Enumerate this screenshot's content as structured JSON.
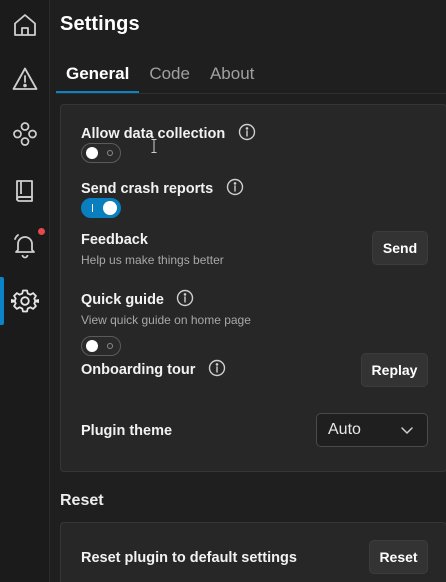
{
  "rail": {
    "items": [
      {
        "icon": "home-icon"
      },
      {
        "icon": "warning-icon"
      },
      {
        "icon": "nodes-icon"
      },
      {
        "icon": "book-icon"
      },
      {
        "icon": "bell-icon"
      },
      {
        "icon": "gear-icon"
      }
    ]
  },
  "header": {
    "title": "Settings"
  },
  "tabs": [
    {
      "label": "General",
      "active": true
    },
    {
      "label": "Code",
      "active": false
    },
    {
      "label": "About",
      "active": false
    }
  ],
  "general": {
    "allow_data": {
      "label": "Allow data collection",
      "on": false
    },
    "crash_reports": {
      "label": "Send crash reports",
      "on": true
    },
    "feedback": {
      "label": "Feedback",
      "sub": "Help us make things better",
      "button": "Send"
    },
    "quick_guide": {
      "label": "Quick guide",
      "sub": "View quick guide on home page",
      "on": false
    },
    "onboarding": {
      "label": "Onboarding tour",
      "button": "Replay"
    },
    "plugin_theme": {
      "label": "Plugin theme",
      "value": "Auto"
    }
  },
  "reset": {
    "title": "Reset",
    "row_label": "Reset plugin to default settings",
    "button": "Reset"
  },
  "colors": {
    "accent": "#0a84c6",
    "notification": "#e5484d",
    "background": "#1f1f1f",
    "card": "#272727"
  }
}
